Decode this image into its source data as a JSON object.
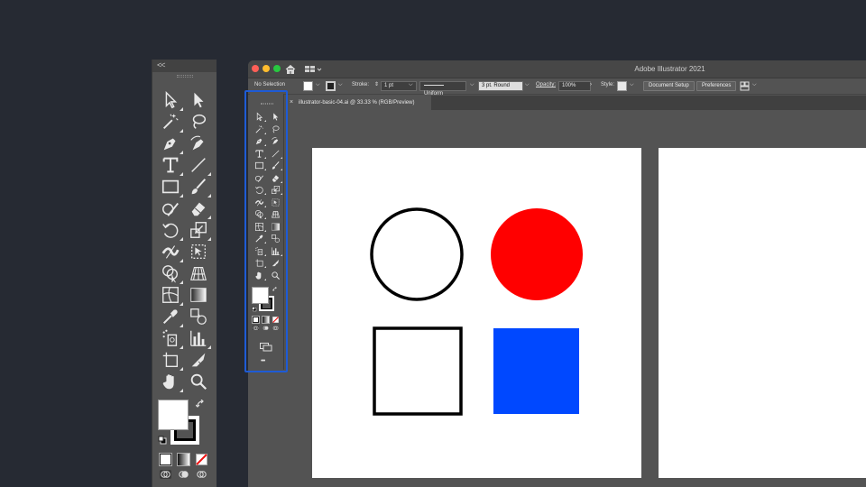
{
  "big_panel": {
    "collapse_label": "<<"
  },
  "window": {
    "app_title": "Adobe Illustrator 2021",
    "traffic_colors": [
      "#fe5f57",
      "#febc2e",
      "#28c840"
    ]
  },
  "control_bar": {
    "selection": "No Selection",
    "stroke_label": "Stroke:",
    "stroke_weight": "1 pt",
    "uniform": "Uniform",
    "brush": "3 pt. Round",
    "opacity_label": "Opacity:",
    "opacity_value": "100%",
    "style_label": "Style:",
    "document_setup": "Document Setup",
    "preferences": "Preferences"
  },
  "document": {
    "tab_title": "illustrator-basic-04.ai @ 33.33 % (RGB/Preview)",
    "close_glyph": "×"
  },
  "small_bar": {
    "more_label": "•••"
  },
  "artwork": {
    "filled_circle_color": "#ff0000",
    "filled_square_color": "#0048ff",
    "stroke_color": "#000000"
  },
  "tools": [
    "selection-tool",
    "direct-selection-tool",
    "magic-wand-tool",
    "lasso-tool",
    "pen-tool",
    "curvature-tool",
    "type-tool",
    "line-segment-tool",
    "rectangle-tool",
    "paintbrush-tool",
    "shaper-tool",
    "eraser-tool",
    "rotate-tool",
    "scale-tool",
    "width-tool",
    "free-transform-tool",
    "shape-builder-tool",
    "perspective-grid-tool",
    "mesh-tool",
    "gradient-tool",
    "eyedropper-tool",
    "blend-tool",
    "symbol-sprayer-tool",
    "column-graph-tool",
    "artboard-tool",
    "slice-tool",
    "hand-tool",
    "zoom-tool"
  ]
}
